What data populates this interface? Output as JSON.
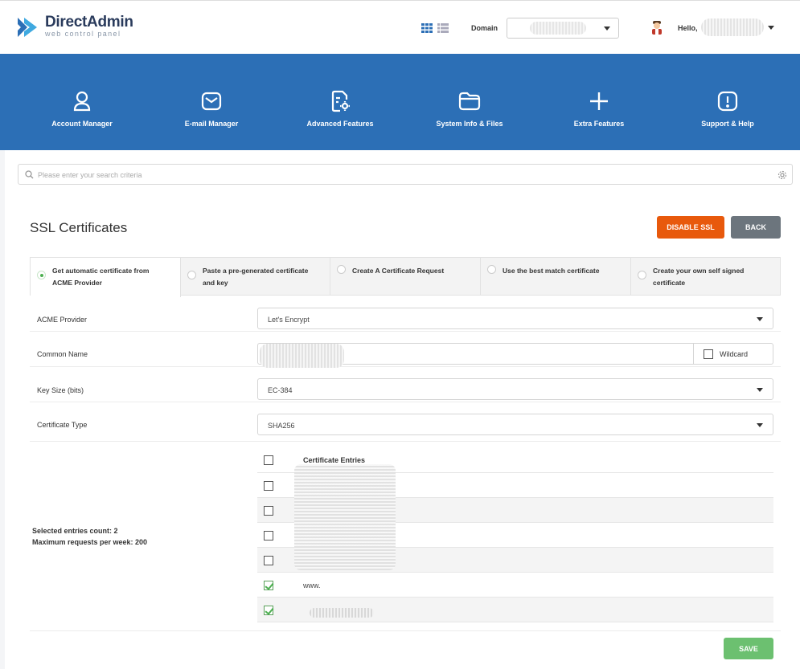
{
  "header": {
    "logo_title": "DirectAdmin",
    "logo_subtitle": "web control panel",
    "domain_label": "Domain",
    "hello_label": "Hello,"
  },
  "nav": {
    "items": [
      {
        "label": "Account Manager",
        "icon": "user-icon"
      },
      {
        "label": "E-mail Manager",
        "icon": "mail-icon"
      },
      {
        "label": "Advanced Features",
        "icon": "advanced-file-gear-icon"
      },
      {
        "label": "System Info & Files",
        "icon": "folder-icon"
      },
      {
        "label": "Extra Features",
        "icon": "plus-icon"
      },
      {
        "label": "Support & Help",
        "icon": "alert-icon"
      }
    ]
  },
  "search": {
    "placeholder": "Please enter your search criteria"
  },
  "page": {
    "title": "SSL Certificates",
    "disable_ssl_label": "DISABLE SSL",
    "back_label": "BACK"
  },
  "tabs": [
    {
      "label_line1": "Get automatic certificate from",
      "label_line2": "ACME Provider",
      "active": true
    },
    {
      "label_line1": "Paste a pre-generated certificate",
      "label_line2": "and key",
      "active": false
    },
    {
      "label_line1": "Create A Certificate Request",
      "label_line2": "",
      "active": false
    },
    {
      "label_line1": "Use the best match certificate",
      "label_line2": "",
      "active": false
    },
    {
      "label_line1": "Create your own self signed",
      "label_line2": "certificate",
      "active": false
    }
  ],
  "form": {
    "acme_provider_label": "ACME Provider",
    "acme_provider_value": "Let's Encrypt",
    "common_name_label": "Common Name",
    "wildcard_label": "Wildcard",
    "key_size_label": "Key Size (bits)",
    "key_size_value": "EC-384",
    "cert_type_label": "Certificate Type",
    "cert_type_value": "SHA256"
  },
  "entries": {
    "header": "Certificate Entries",
    "rows": [
      {
        "text": "",
        "checked": false
      },
      {
        "text": "",
        "checked": false
      },
      {
        "text": "",
        "checked": false
      },
      {
        "text": "",
        "checked": false
      },
      {
        "text": "www.",
        "checked": true
      },
      {
        "text": "",
        "checked": true
      }
    ]
  },
  "stats": {
    "selected": "Selected entries count: 2",
    "maximum": "Maximum requests per week: 200"
  },
  "save_label": "SAVE",
  "colors": {
    "nav_bg": "#2c6fb6",
    "disable_btn": "#e8590c",
    "back_btn": "#6c757d",
    "save_btn": "#6cc070",
    "check_green": "#4caf50"
  }
}
